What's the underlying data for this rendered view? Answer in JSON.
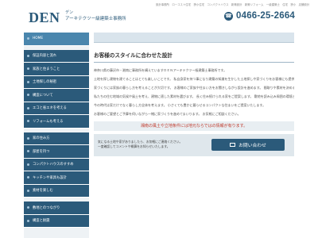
{
  "header": {
    "logo_text": "DEN",
    "logo_reading": "デン",
    "company_name": "アーキテクツー級建築士事務所",
    "tags": "設計事務所　ローコスト住宅　狭小住宅　コンパクトハウス　新築設計　新築リフォーム　一級建築士　住宅　狭小　店舗設計",
    "phone": "0466-25-2664"
  },
  "sidebar": {
    "items": [
      "HOME",
      "保証内容と流れ",
      "家族と住まうこと",
      "土地探しの秘密",
      "構造について",
      "エコと省エネを考える",
      "リフォームも考える",
      "家の住み方",
      "部屋を持つ",
      "コンパクトハウスのすすめ",
      "キッチンや家具も設計",
      "素材を楽しむ",
      "敷地とのつながり",
      "構造と耐震"
    ]
  },
  "main": {
    "title": "お客様のスタイルに合わせた設計",
    "paragraphs": [
      "神奈川県の藤沢市・湘南に事務所を構えていますＤＥＮアーキテクツー級建築士事務所です。",
      "土地を探し建物を建てることはとても楽しいことです。\n私自身家を持つ事になり建築の知識を生かした土地探しや家づくりをお客様にも提供したいと考えております。",
      "家づくりには家族の暮らし方を考えることが大切です。\nお客様のご家族や住まい方をお聞きしながら設計を進めます。\n間取りや素材を決める過程も楽しんでいただける家づくりを大切にしております。",
      "私たちの住む地域の気候や風土を考え、建物に適した素材を選びます。\n長く住み続けられる家をご提案します。\n敷地を読み込み周囲の環境との関係を大切に考えます。",
      "今の時代は家だけでなく暮らし方全体を考えます。\n小さくても豊かに暮らせるコンパクトな住まいをご提案いたします。",
      "お客様のご要望とご予算を伺いながら一緒に家づくりを進めてまいります。\nお気軽にご相談ください。"
    ],
    "notice": "湘南の風土や立地条件には地元ならではの情報が有ります。",
    "contact_lines": [
      "気になる土地や家がありましたら、お気軽にご連絡ください。",
      "一度確認してコメントや概算をお知らせいたします。"
    ],
    "contact_button": "お問い合わせ"
  }
}
